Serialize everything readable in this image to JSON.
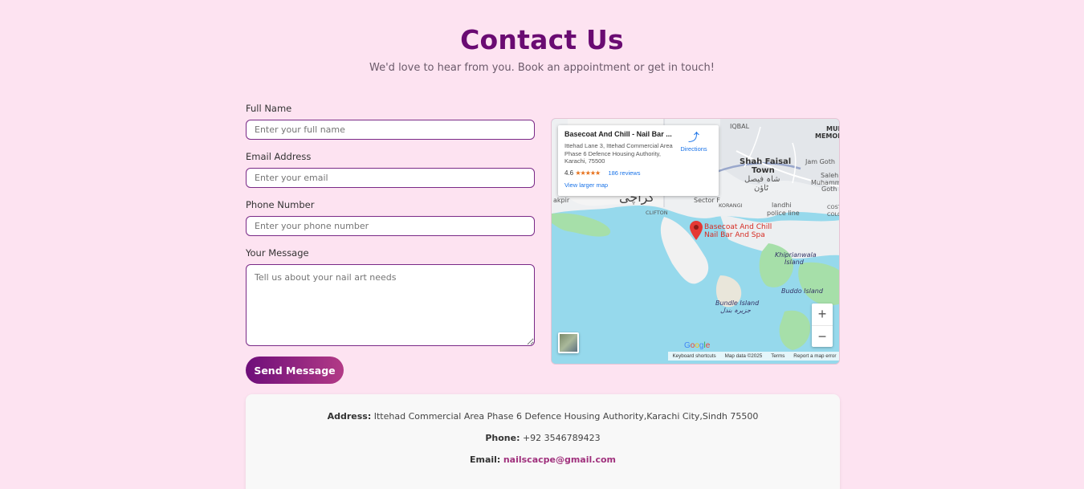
{
  "header": {
    "title": "Contact Us",
    "subtitle": "We'd love to hear from you. Book an appointment or get in touch!"
  },
  "form": {
    "full_name": {
      "label": "Full Name",
      "placeholder": "Enter your full name",
      "value": ""
    },
    "email": {
      "label": "Email Address",
      "placeholder": "Enter your email",
      "value": ""
    },
    "phone": {
      "label": "Phone Number",
      "placeholder": "Enter your phone number",
      "value": ""
    },
    "message": {
      "label": "Your Message",
      "placeholder": "Tell us about your nail art needs",
      "value": ""
    },
    "submit_label": "Send Message"
  },
  "map": {
    "place_card": {
      "title": "Basecoat And Chill - Nail Bar ...",
      "address": "Ittehad Lane 3, Ittehad Commercial Area Phase 6 Defence Housing Authority, Karachi, 75500",
      "rating": "4.6",
      "stars": "★★★★★",
      "reviews": "186 reviews",
      "view_larger": "View larger map",
      "directions": "Directions"
    },
    "labels": {
      "shah_faisal": "Shah Faisal",
      "town": "Town",
      "shah_faisal_urdu": "شاہ فیصل",
      "town_urdu": "ٹاؤن",
      "iqbal": "IQBAL",
      "mur": "MUR",
      "memon": "MEMON",
      "jam_goth": "Jam Goth",
      "saleh": "Saleh",
      "muhammad": "Muhamma",
      "goth": "Goth",
      "karachi_urdu": "کراچی",
      "akpir": "akpir",
      "clifton": "CLIFTON",
      "sector_f": "Sector F",
      "korangi": "KORANGI",
      "landhi": "landhi",
      "police_line": "police line",
      "cost": "COST",
      "colo": "COLO",
      "pin_label_1": "Basecoat And Chill",
      "pin_label_2": "Nail Bar And Spa",
      "khiprianwala": "Khiprianwala",
      "island": "Island",
      "buddo": "Buddo Island",
      "bundle": "Bundle Island",
      "bundle_urdu": "جزیرہ بندل"
    },
    "zoom_in": "+",
    "zoom_out": "−",
    "google": "Google",
    "footer": {
      "shortcuts": "Keyboard shortcuts",
      "data": "Map data ©2025",
      "terms": "Terms",
      "report": "Report a map error"
    }
  },
  "contact_info": {
    "address_label": "Address:",
    "address_value": "Ittehad Commercial Area Phase 6 Defence Housing Authority,Karachi City,Sindh 75500",
    "phone_label": "Phone:",
    "phone_value": "+92 3546789423",
    "email_label": "Email:",
    "email_value": "nailscacpe@gmail.com"
  },
  "colors": {
    "background": "#fde3f1",
    "title": "#6a0b72",
    "button_gradient_start": "#6e0e7a",
    "button_gradient_end": "#b23a86",
    "link": "#a0317d"
  }
}
